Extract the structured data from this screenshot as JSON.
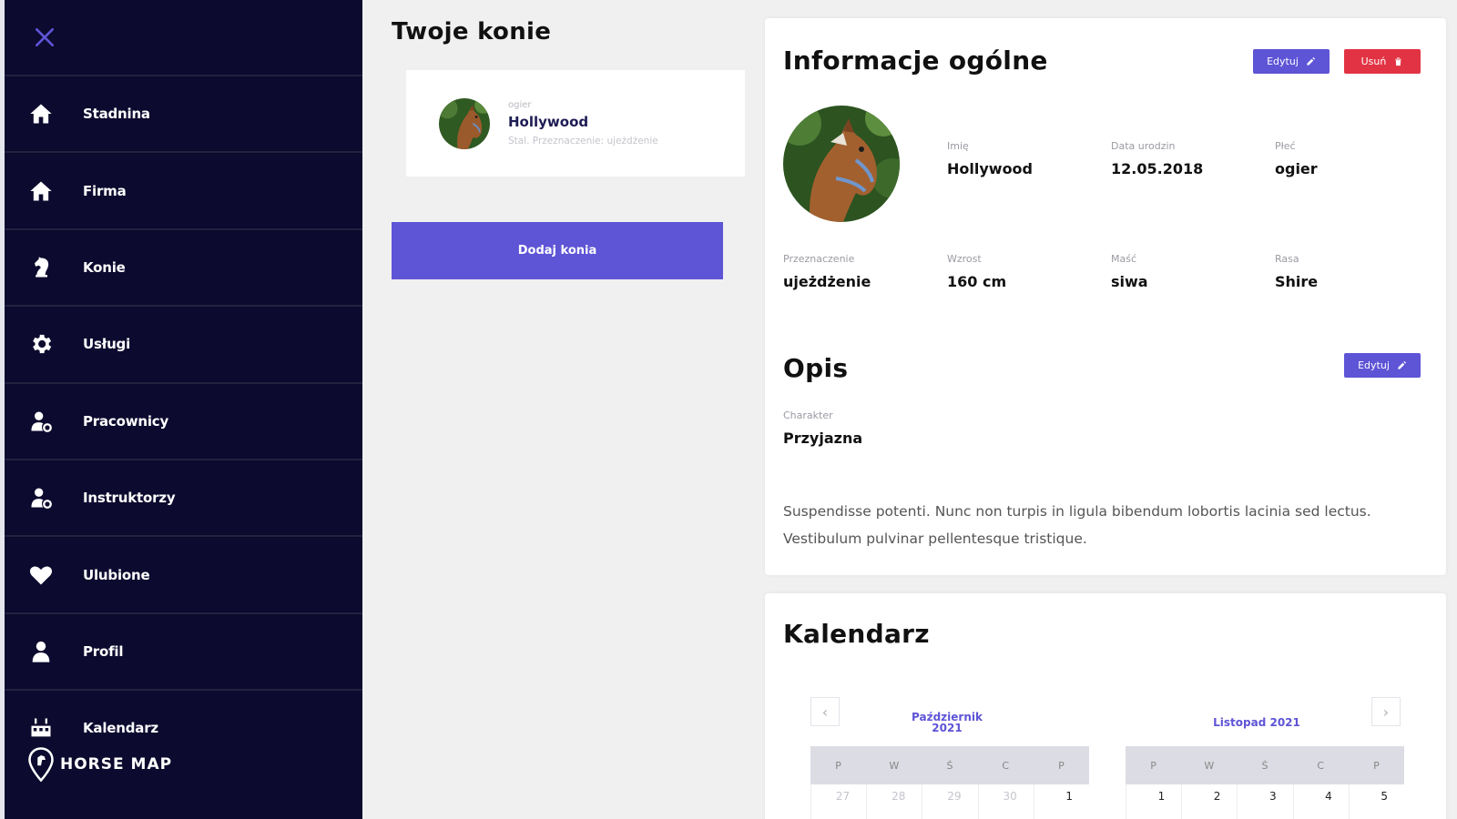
{
  "sidebar": {
    "items": [
      {
        "label": "Stadnina",
        "icon": "home-icon"
      },
      {
        "label": "Firma",
        "icon": "home-icon"
      },
      {
        "label": "Konie",
        "icon": "horse-icon"
      },
      {
        "label": "Usługi",
        "icon": "gear-icon"
      },
      {
        "label": "Pracownicy",
        "icon": "user-settings-icon"
      },
      {
        "label": "Instruktorzy",
        "icon": "user-settings-icon"
      },
      {
        "label": "Ulubione",
        "icon": "heart-icon"
      },
      {
        "label": "Profil",
        "icon": "user-icon"
      },
      {
        "label": "Kalendarz",
        "icon": "calendar-icon"
      }
    ],
    "brand": "HORSE MAP"
  },
  "horses_panel": {
    "title": "Twoje konie",
    "horse": {
      "gender": "ogier",
      "name": "Hollywood",
      "meta": "Stal. Przeznaczenie: ujeżdżenie"
    },
    "add_button": "Dodaj konia"
  },
  "info": {
    "title": "Informacje ogólne",
    "edit_label": "Edytuj",
    "delete_label": "Usuń",
    "fields": {
      "name": {
        "label": "Imię",
        "value": "Hollywood"
      },
      "birth": {
        "label": "Data urodzin",
        "value": "12.05.2018"
      },
      "sex": {
        "label": "Płeć",
        "value": "ogier"
      },
      "purpose": {
        "label": "Przeznaczenie",
        "value": "ujeżdżenie"
      },
      "height": {
        "label": "Wzrost",
        "value": "160 cm"
      },
      "color": {
        "label": "Maść",
        "value": "siwa"
      },
      "breed": {
        "label": "Rasa",
        "value": "Shire"
      }
    }
  },
  "description": {
    "title": "Opis",
    "edit_label": "Edytuj",
    "character_label": "Charakter",
    "character_value": "Przyjazna",
    "text": "Suspendisse potenti. Nunc non turpis in ligula bibendum lobortis lacinia sed lectus. Vestibulum pulvinar pellentesque tristique."
  },
  "calendar": {
    "title": "Kalendarz",
    "left_month": "Październik 2021",
    "right_month": "Listopad 2021",
    "weekdays": [
      "P",
      "W",
      "Ś",
      "C",
      "P"
    ],
    "left_days": [
      "27",
      "28",
      "29",
      "30",
      "1"
    ],
    "right_days": [
      "1",
      "2",
      "3",
      "4",
      "5"
    ]
  },
  "colors": {
    "sidebar_bg": "#0c0a2e",
    "accent": "#5e54d6",
    "danger": "#e23344"
  }
}
